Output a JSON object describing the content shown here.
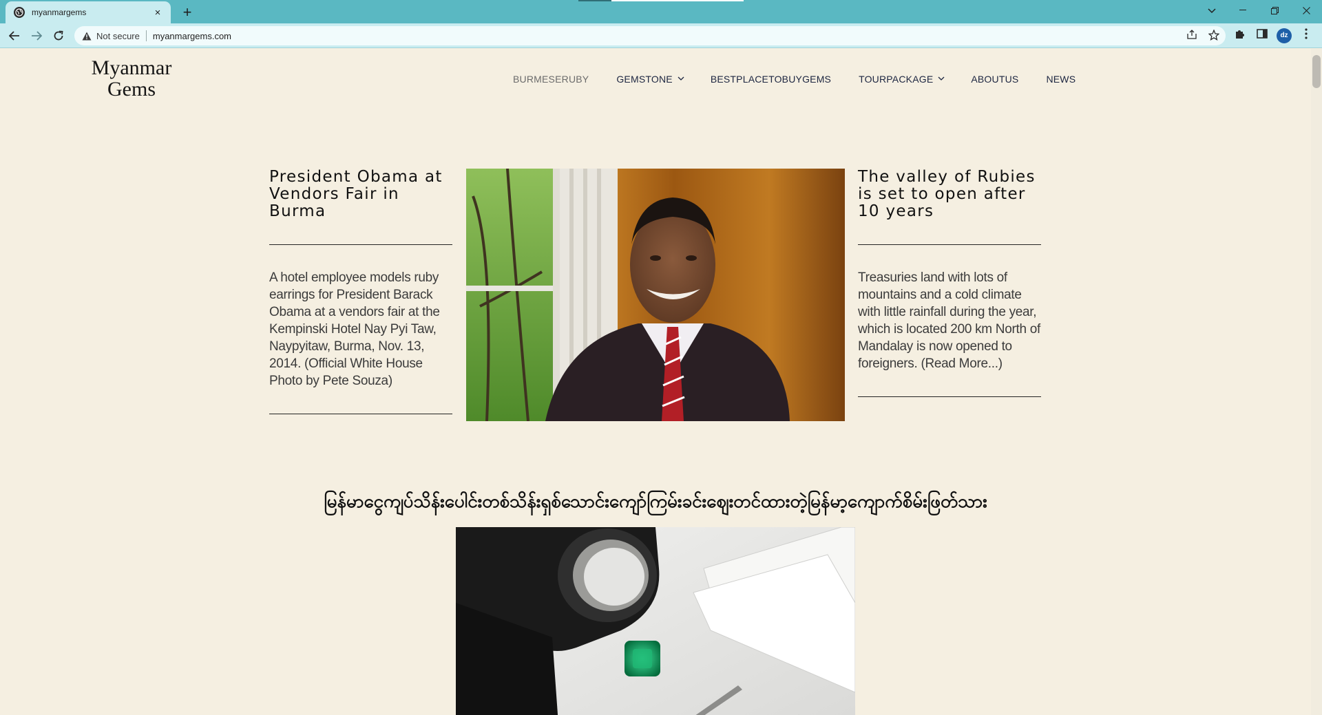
{
  "browser": {
    "tab_title": "myanmargems",
    "tab_close": "×",
    "new_tab": "+",
    "security_label": "Not secure",
    "url": "myanmargems.com",
    "profile_initials": "dz"
  },
  "site": {
    "logo_line1": "Myanmar",
    "logo_line2": "Gems"
  },
  "nav": {
    "items": [
      {
        "label": "BURMESERUBY",
        "active": true,
        "dropdown": false
      },
      {
        "label": "GEMSTONE",
        "active": false,
        "dropdown": true
      },
      {
        "label": "BESTPLACETOBUYGEMS",
        "active": false,
        "dropdown": false
      },
      {
        "label": "TOURPACKAGE",
        "active": false,
        "dropdown": true
      },
      {
        "label": "ABOUTUS",
        "active": false,
        "dropdown": false
      },
      {
        "label": "NEWS",
        "active": false,
        "dropdown": false
      }
    ]
  },
  "feature": {
    "left": {
      "title": "President Obama at Vendors Fair in Burma",
      "text": "A hotel employee models ruby earrings for President Barack Obama at a vendors fair at the Kempinski Hotel Nay Pyi Taw, Naypyitaw, Burma, Nov. 13, 2014. (Official White House Photo by Pete Souza)"
    },
    "right": {
      "title": "The valley of Rubies is set to open after 10 years",
      "text": "Treasuries land with lots of mountains and a cold climate with little rainfall during the year, which is located 200 km North of Mandalay is now opened to foreigners. (Read More...)"
    }
  },
  "section": {
    "heading": "မြန်မာငွေကျပ်သိန်းပေါင်းတစ်သိန်းရှစ်သောင်းကျော်ကြမ်းခင်းဈေးတင်ထားတဲ့မြန်မာ့ကျောက်စိမ်းဖြတ်သား"
  },
  "colors": {
    "chrome": "#5ab8c2",
    "page_bg": "#f5efe1",
    "nav_text": "#1c2540"
  }
}
